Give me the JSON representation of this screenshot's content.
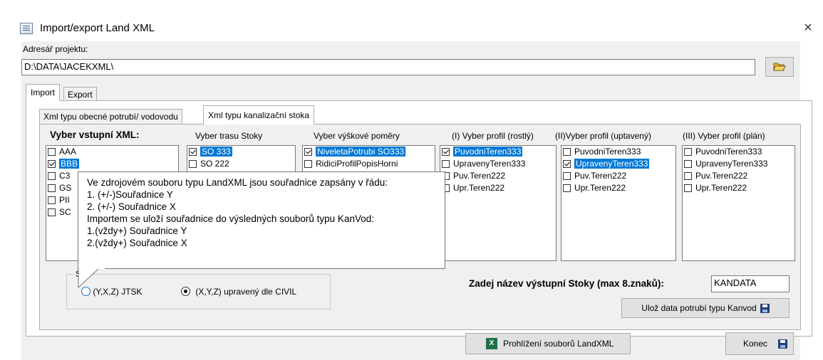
{
  "window": {
    "title": "Import/export Land XML",
    "close_glyph": "×"
  },
  "project": {
    "label": "Adresář projektu:",
    "path": "D:\\DATA\\JACEKXML\\"
  },
  "tabs": [
    {
      "label": "Import",
      "active": true
    },
    {
      "label": "Export",
      "active": false
    }
  ],
  "subtabs": [
    {
      "label": "Xml typu obecné potrubí/ vodovodu",
      "active": false
    },
    {
      "label": "Xml typu kanalizační stoka",
      "active": true
    }
  ],
  "lists": {
    "xml": {
      "header": "Vyber vstupní XML:",
      "items": [
        {
          "label": "AAA",
          "checked": false,
          "selected": false
        },
        {
          "label": "BBB",
          "checked": true,
          "selected": true
        },
        {
          "label": "C3",
          "checked": false,
          "selected": false
        },
        {
          "label": "GS",
          "checked": false,
          "selected": false
        },
        {
          "label": "PII",
          "checked": false,
          "selected": false
        },
        {
          "label": "SC",
          "checked": false,
          "selected": false
        }
      ]
    },
    "trasa": {
      "header": "Vyber trasu Stoky",
      "items": [
        {
          "label": "SO 333",
          "checked": true,
          "selected": true
        },
        {
          "label": "SO 222",
          "checked": false,
          "selected": false
        }
      ]
    },
    "vyskove": {
      "header": "Vyber výškové poměry",
      "items": [
        {
          "label": "NiveletaPotrubi SO333",
          "checked": true,
          "selected": true
        },
        {
          "label": "RidiciProfilPopisHorni",
          "checked": false,
          "selected": false
        }
      ]
    },
    "rostly": {
      "header": "(I) Vyber profil (rostlý)",
      "items": [
        {
          "label": "PuvodniTeren333",
          "checked": true,
          "selected": true
        },
        {
          "label": "UpravenyTeren333",
          "checked": false,
          "selected": false
        },
        {
          "label": "Puv.Teren222",
          "checked": false,
          "selected": false
        },
        {
          "label": "Upr.Teren222",
          "checked": false,
          "selected": false
        }
      ]
    },
    "upraveny": {
      "header": "(II)Vyber profil (uptavený)",
      "items": [
        {
          "label": "PuvodniTeren333",
          "checked": false,
          "selected": false
        },
        {
          "label": "UpravenyTeren333",
          "checked": true,
          "selected": true
        },
        {
          "label": "Puv.Teren222",
          "checked": false,
          "selected": false
        },
        {
          "label": "Upr.Teren222",
          "checked": false,
          "selected": false
        }
      ]
    },
    "plan": {
      "header": "(III) Vyber  profil (plán)",
      "items": [
        {
          "label": "PuvodniTeren333",
          "checked": false,
          "selected": false
        },
        {
          "label": "UpravenyTeren333",
          "checked": false,
          "selected": false
        },
        {
          "label": "Puv.Teren222",
          "checked": false,
          "selected": false
        },
        {
          "label": "Upr.Teren222",
          "checked": false,
          "selected": false
        }
      ]
    }
  },
  "tooltip": {
    "lines": [
      "Ve zdrojovém souboru typu LandXML jsou souřadnice zapsány v  řádu:",
      "1.  (+/-)Souřadnice Y",
      "2.  (+/-) Souřadnice X",
      "Importem  se  uloží souřadnice do výsledných souborů typu KanVod:",
      "1.(vždy+) Souřadnice Y",
      "2.(vždy+) Souřadnice X"
    ]
  },
  "coords": {
    "group_label_partial": "Sy",
    "option1": "(Y,X,Z) JTSK",
    "option2": "(X,Y,Z) upravený dle CIVIL",
    "selected": "option2"
  },
  "output": {
    "label": "Zadej název výstupní Stoky  (max 8.znaků):",
    "value": "KANDATA",
    "save_button": "Ulož data potrubí typu Kanvod"
  },
  "footer": {
    "view_button": "Prohlížení souborů LandXML",
    "end_button": "Konec"
  },
  "icons": {
    "accent": "#0078d7"
  }
}
